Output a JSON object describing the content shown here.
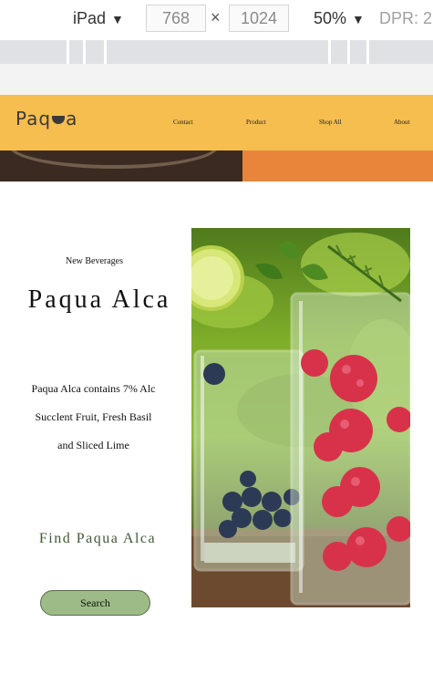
{
  "devtools": {
    "device": "iPad",
    "width": "768",
    "height": "1024",
    "times": "×",
    "zoom": "50%",
    "dpr": "DPR: 2."
  },
  "site": {
    "logo_text_1": "Paq",
    "logo_text_2": "a",
    "nav": [
      "Contact",
      "Product",
      "Shop All",
      "About"
    ],
    "eyebrow": "New Beverages",
    "title": "Paqua Alca",
    "desc_lines": [
      "Paqua Alca contains 7% Alc",
      "Succlent Fruit, Fresh Basil",
      "and Sliced Lime"
    ],
    "find": "Find Paqua Alca",
    "search_label": "Search"
  },
  "colors": {
    "header": "#f6bd4f",
    "banner_orange": "#e8853a",
    "button": "#9dbb86",
    "find_text": "#3f5a35"
  }
}
